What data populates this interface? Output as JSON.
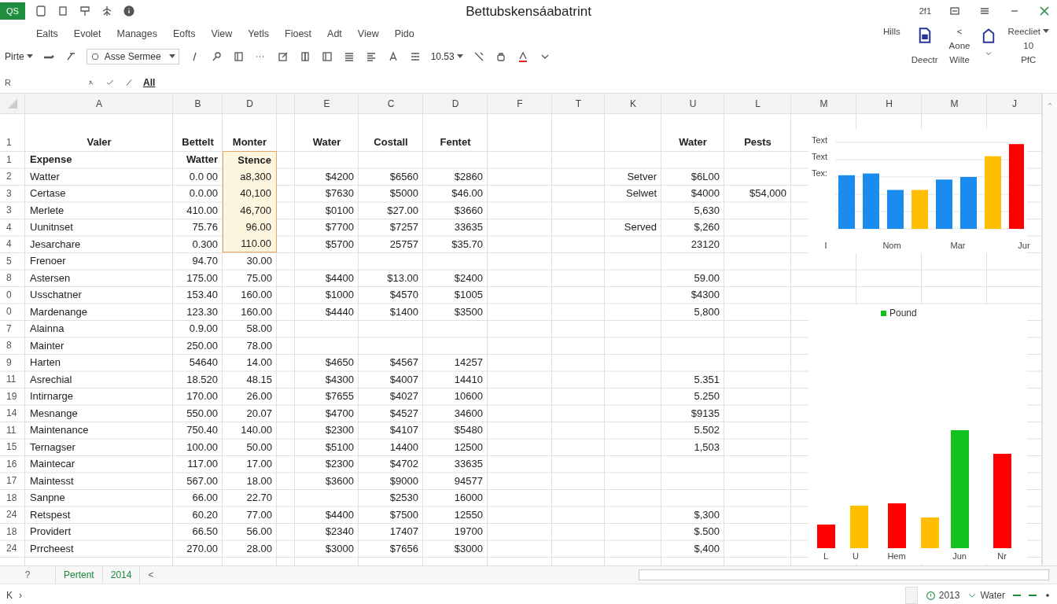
{
  "title_bar": {
    "app_badge": "QS",
    "title": "Bettubskensáabatrint",
    "counter": "2f1"
  },
  "menu": [
    "Ealts",
    "Evolet",
    "Manages",
    "Eofts",
    "View",
    "Yetls",
    "Fioest",
    "Adt",
    "View",
    "Pido"
  ],
  "ribbon": {
    "paste": "Pirte",
    "font": "Asse Sermee",
    "font_size": "10.53"
  },
  "command_group": [
    {
      "kind": "text",
      "top": "Hills"
    },
    {
      "kind": "doc",
      "bottom": "Deectr"
    },
    {
      "kind": "text",
      "top": "<",
      "middle": "Aone",
      "bottom": "Wilte"
    },
    {
      "kind": "home"
    },
    {
      "kind": "dropdown",
      "top": "Reecliet",
      "middle": "10",
      "bottom": "PfC"
    }
  ],
  "formula_bar": {
    "name_box": "R",
    "content": "All"
  },
  "sheet": {
    "columns": [
      "A",
      "B",
      "D",
      "E",
      "C",
      "D",
      "F",
      "T",
      "K",
      "U",
      "L",
      "M",
      "H",
      "M",
      "J"
    ],
    "rows": [
      {
        "kind": "header",
        "number": "1",
        "cells": {
          "A": "Valer",
          "B": "Bettelt",
          "D": "Monter",
          "E": "Water",
          "C": "Costall",
          "D_2": "Fentet",
          "U": "Water",
          "L": "Pests"
        }
      },
      {
        "kind": "subheader",
        "number": "1",
        "d_selected": true,
        "cells": {
          "A": "Expense",
          "B": "Watter",
          "D": "Stence"
        }
      },
      {
        "kind": "data",
        "number": "2",
        "d_selected": true,
        "cells": {
          "A": "Watter",
          "B": "0.0 00",
          "D": "a8,300",
          "E": "$4200",
          "C": "$6560",
          "D_2": "$2860",
          "K": "Setver",
          "U": "$6L00"
        }
      },
      {
        "kind": "data",
        "number": "3",
        "d_selected": true,
        "cells": {
          "A": "Certase",
          "B": "0.0.00",
          "D": "40,100",
          "E": "$7630",
          "C": "$5000",
          "D_2": "$46.00",
          "K": "Selwet",
          "U": "$4000",
          "L": "$54,000"
        }
      },
      {
        "kind": "data",
        "number": "3",
        "d_selected": true,
        "cells": {
          "A": "Merlete",
          "B": "410.00",
          "D": "46,700",
          "E": "$0100",
          "C": "$27.00",
          "D_2": "$3660",
          "U": "5,630"
        }
      },
      {
        "kind": "data",
        "number": "4",
        "d_selected": true,
        "cells": {
          "A": "Uunitnset",
          "B": "75.76",
          "D": "96.00",
          "E": "$7700",
          "C": "$7257",
          "D_2": "33635",
          "K": "Served",
          "U": "$,260"
        }
      },
      {
        "kind": "data",
        "number": "4",
        "d_selected": true,
        "cells": {
          "A": "Jesarchare",
          "B": "0.300",
          "D": "110.00",
          "E": "$5700",
          "C": "25757",
          "D_2": "$35.70",
          "U": "23120"
        }
      },
      {
        "kind": "data",
        "number": "5",
        "d_selected": false,
        "cells": {
          "A": "Frenoer",
          "B": "94.70",
          "D": "30.00"
        }
      },
      {
        "kind": "data",
        "number": "8",
        "d_selected": false,
        "cells": {
          "A": "Astersen",
          "B": "175.00",
          "D": "75.00",
          "E": "$4400",
          "C": "$13.00",
          "D_2": "$2400",
          "U": "59.00"
        }
      },
      {
        "kind": "data",
        "number": "0",
        "d_selected": false,
        "cells": {
          "A": "Usschatner",
          "B": "153.40",
          "D": "160.00",
          "E": "$1000",
          "C": "$4570",
          "D_2": "$1005",
          "U": "$4300"
        }
      },
      {
        "kind": "data",
        "number": "0",
        "d_selected": false,
        "cells": {
          "A": "Mardenange",
          "B": "123.30",
          "D": "160.00",
          "E": "$4440",
          "C": "$1400",
          "D_2": "$3500",
          "U": "5,800"
        }
      },
      {
        "kind": "data",
        "number": "7",
        "d_selected": false,
        "cells": {
          "A": "Alainna",
          "B": "0.9.00",
          "D": "58.00"
        }
      },
      {
        "kind": "data",
        "number": "8",
        "d_selected": false,
        "cells": {
          "A": "Mainter",
          "B": "250.00",
          "D": "78.00"
        }
      },
      {
        "kind": "data",
        "number": "9",
        "d_selected": false,
        "cells": {
          "A": "Harten",
          "B": "54640",
          "D": "14.00",
          "E": "$4650",
          "C": "$4567",
          "D_2": "14257"
        }
      },
      {
        "kind": "data",
        "number": "11",
        "d_selected": false,
        "cells": {
          "A": "Asrechial",
          "B": "18.520",
          "D": "48.15",
          "E": "$4300",
          "C": "$4007",
          "D_2": "14410",
          "U": "5.351"
        }
      },
      {
        "kind": "data",
        "number": "19",
        "d_selected": false,
        "cells": {
          "A": "Intirnarge",
          "B": "170.00",
          "D": "26.00",
          "E": "$7655",
          "C": "$4027",
          "D_2": "10600",
          "U": "5.250"
        }
      },
      {
        "kind": "data",
        "number": "14",
        "d_selected": false,
        "cells": {
          "A": "Mesnange",
          "B": "550.00",
          "D": "20.07",
          "E": "$4700",
          "C": "$4527",
          "D_2": "34600",
          "U": "$9135"
        }
      },
      {
        "kind": "data",
        "number": "11",
        "d_selected": false,
        "cells": {
          "A": "Maintenance",
          "B": "750.40",
          "D": "140.00",
          "E": "$2300",
          "C": "$4107",
          "D_2": "$5480",
          "U": "5.502"
        }
      },
      {
        "kind": "data",
        "number": "15",
        "d_selected": false,
        "cells": {
          "A": "Ternagser",
          "B": "100.00",
          "D": "50.00",
          "E": "$5100",
          "C": "14400",
          "D_2": "12500",
          "U": "1,503"
        }
      },
      {
        "kind": "data",
        "number": "16",
        "d_selected": false,
        "cells": {
          "A": "Maintecar",
          "B": "117.00",
          "D": "17.00",
          "E": "$2300",
          "C": "$4702",
          "D_2": "33635"
        }
      },
      {
        "kind": "data",
        "number": "17",
        "d_selected": false,
        "cells": {
          "A": "Maintesst",
          "B": "567.00",
          "D": "18.00",
          "E": "$3600",
          "C": "$9000",
          "D_2": "94577"
        }
      },
      {
        "kind": "data",
        "number": "18",
        "d_selected": false,
        "cells": {
          "A": "Sanpne",
          "B": "66.00",
          "D": "22.70",
          "C": "$2530",
          "D_2": "16000"
        }
      },
      {
        "kind": "data",
        "number": "24",
        "d_selected": false,
        "cells": {
          "A": "Retspest",
          "B": "60.20",
          "D": "77.00",
          "E": "$4400",
          "C": "$7500",
          "D_2": "12550",
          "U": "$,300"
        }
      },
      {
        "kind": "data",
        "number": "18",
        "d_selected": false,
        "cells": {
          "A": "Providert",
          "B": "66.50",
          "D": "56.00",
          "E": "$2340",
          "C": "17407",
          "D_2": "19700",
          "U": "$.500"
        }
      },
      {
        "kind": "data",
        "number": "24",
        "d_selected": false,
        "cells": {
          "A": "Prrcheest",
          "B": "270.00",
          "D": "28.00",
          "E": "$3000",
          "C": "$7656",
          "D_2": "$3000",
          "U": "$,400"
        }
      }
    ]
  },
  "charts": [
    {
      "y_labels": [
        "Text",
        "Text",
        "Tex:"
      ],
      "x_labels": [
        "I",
        "Nom",
        "Mar",
        "Jur"
      ]
    },
    {
      "legend": "Pound",
      "x_labels": [
        "L",
        "U",
        "Hem",
        "Jun",
        "Nr"
      ]
    }
  ],
  "sheet_tabs": [
    "?",
    "Pertent",
    "2014"
  ],
  "tab_scroll": "<",
  "status_bar": {
    "left": [
      "K",
      "›"
    ],
    "year": "2013",
    "label": "Water"
  }
}
